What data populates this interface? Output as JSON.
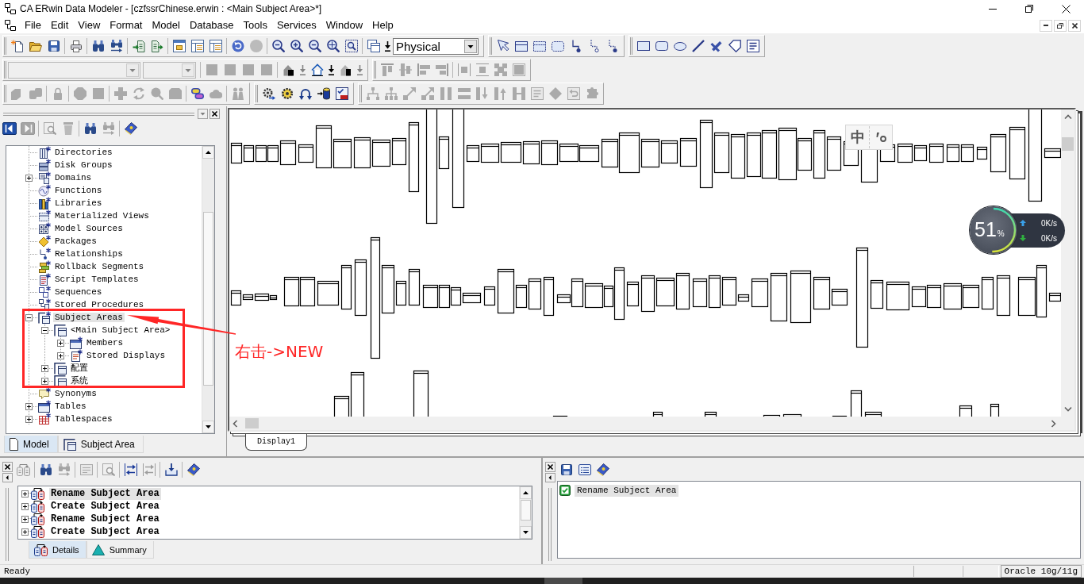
{
  "window": {
    "title": "CA ERwin Data Modeler - [czfssrChinese.erwin : <Main Subject Area>*]"
  },
  "menu": [
    "File",
    "Edit",
    "View",
    "Format",
    "Model",
    "Database",
    "Tools",
    "Services",
    "Window",
    "Help"
  ],
  "toolbars": [
    {
      "combos": [
        {
          "value": "Physical",
          "disabled": false
        }
      ],
      "buttons": [
        {
          "disabled": false
        },
        {
          "disabled": false
        },
        {
          "disabled": false
        },
        {
          "disabled": false
        },
        {
          "disabled": false
        },
        {
          "disabled": false
        },
        {
          "disabled": false
        },
        {
          "disabled": false
        },
        {
          "disabled": false
        },
        {
          "disabled": false
        },
        {
          "disabled": false
        },
        {
          "disabled": false
        },
        {
          "disabled": true
        },
        {
          "disabled": false
        },
        {
          "disabled": false
        },
        {
          "disabled": false
        },
        {
          "disabled": false
        },
        {
          "disabled": false
        },
        {
          "disabled": false
        },
        {
          "disabled": false
        },
        {
          "disabled": false
        },
        {
          "disabled": false
        },
        {
          "disabled": false
        },
        {
          "disabled": false
        },
        {
          "disabled": false
        },
        {
          "disabled": false
        },
        {
          "disabled": false
        },
        {
          "disabled": false
        },
        {
          "disabled": false
        },
        {
          "disabled": false
        },
        {
          "disabled": false
        },
        {
          "disabled": false
        },
        {
          "disabled": false
        },
        {
          "disabled": false
        }
      ]
    },
    {
      "combos": [
        {
          "disabled": true
        },
        {
          "disabled": true
        }
      ],
      "buttons": [
        {
          "disabled": true
        },
        {
          "disabled": true
        },
        {
          "disabled": true
        },
        {
          "disabled": true
        },
        {
          "disabled": false
        },
        {
          "disabled": true
        },
        {
          "disabled": false
        },
        {
          "disabled": false
        },
        {
          "disabled": false
        },
        {
          "disabled": true
        },
        {
          "disabled": true
        },
        {
          "disabled": true
        },
        {
          "disabled": true
        },
        {
          "disabled": true
        },
        {
          "disabled": true
        },
        {
          "disabled": true
        },
        {
          "disabled": true
        },
        {
          "disabled": true
        }
      ]
    },
    {
      "buttons": [
        {
          "disabled": true
        },
        {
          "disabled": true
        },
        {
          "disabled": true
        },
        {
          "disabled": true
        },
        {
          "disabled": true
        },
        {
          "disabled": true
        },
        {
          "disabled": true
        },
        {
          "disabled": true
        },
        {
          "disabled": true
        },
        {
          "disabled": false
        },
        {
          "disabled": true
        },
        {
          "disabled": true
        },
        {
          "disabled": false
        },
        {
          "disabled": false
        },
        {
          "disabled": false
        },
        {
          "disabled": false
        },
        {
          "disabled": false
        },
        {
          "disabled": true
        },
        {
          "disabled": true
        },
        {
          "disabled": true
        },
        {
          "disabled": true
        },
        {
          "disabled": true
        },
        {
          "disabled": true
        },
        {
          "disabled": true
        },
        {
          "disabled": true
        },
        {
          "disabled": true
        },
        {
          "disabled": true
        },
        {
          "disabled": true
        },
        {
          "disabled": true
        },
        {
          "disabled": true
        }
      ]
    }
  ],
  "explorer": {
    "toolbar": [
      {
        "disabled": false
      },
      {
        "disabled": true
      },
      {
        "disabled": true
      },
      {
        "disabled": true
      },
      {
        "disabled": false
      },
      {
        "disabled": true
      },
      {
        "disabled": false
      }
    ],
    "tree": [
      {
        "label": "Directories",
        "kind": "directory",
        "selected": false
      },
      {
        "label": "Disk Groups",
        "kind": "diskgroup",
        "selected": false
      },
      {
        "label": "Domains",
        "kind": "domain",
        "selected": false,
        "expanded": false
      },
      {
        "label": "Functions",
        "kind": "function",
        "selected": false
      },
      {
        "label": "Libraries",
        "kind": "library",
        "selected": false
      },
      {
        "label": "Materialized Views",
        "kind": "matview",
        "selected": false
      },
      {
        "label": "Model Sources",
        "kind": "source",
        "selected": false
      },
      {
        "label": "Packages",
        "kind": "package",
        "selected": false
      },
      {
        "label": "Relationships",
        "kind": "relationship",
        "selected": false
      },
      {
        "label": "Rollback Segments",
        "kind": "rollback",
        "selected": false
      },
      {
        "label": "Script Templates",
        "kind": "script",
        "selected": false
      },
      {
        "label": "Sequences",
        "kind": "sequence",
        "selected": false
      },
      {
        "label": "Stored Procedures",
        "kind": "procedure",
        "selected": false
      },
      {
        "label": "Subject Areas",
        "kind": "subjectareas",
        "selected": true,
        "expanded": true,
        "children": [
          {
            "label": "<Main Subject Area>",
            "kind": "subjectarea",
            "selected": false,
            "expanded": true,
            "children": [
              {
                "label": "Members",
                "kind": "member",
                "selected": false,
                "expanded": false
              },
              {
                "label": "Stored Displays",
                "kind": "display",
                "selected": false,
                "expanded": false
              }
            ]
          },
          {
            "label": "配置",
            "kind": "subjectarea",
            "selected": false,
            "expanded": false
          },
          {
            "label": "系统",
            "kind": "subjectarea",
            "selected": false,
            "expanded": false
          }
        ]
      },
      {
        "label": "Synonyms",
        "kind": "synonym",
        "selected": false
      },
      {
        "label": "Tables",
        "kind": "table",
        "selected": false,
        "expanded": false
      },
      {
        "label": "Tablespaces",
        "kind": "tablespace",
        "selected": false,
        "expanded": false
      }
    ],
    "tabs": [
      {
        "label": "Model",
        "selected": true
      },
      {
        "label": "Subject Area",
        "selected": false
      }
    ]
  },
  "diagram": {
    "tabs": [
      {
        "label": "Display1",
        "selected": true
      }
    ]
  },
  "ime_bar": {
    "mode": "中"
  },
  "speed_widget": {
    "percent": "51",
    "unit": "%",
    "level": 0.51,
    "upload": "0K/s",
    "download": "0K/s"
  },
  "annotation": {
    "text": "右击->NEW"
  },
  "action_log": {
    "toolbar": [
      {
        "disabled": true
      },
      {
        "disabled": false
      },
      {
        "disabled": true
      },
      {
        "disabled": true
      },
      {
        "disabled": true
      },
      {
        "disabled": false
      },
      {
        "disabled": true
      },
      {
        "disabled": false
      },
      {
        "disabled": false
      }
    ],
    "rows": [
      {
        "label": "Rename Subject Area",
        "expanded": false,
        "selected": true
      },
      {
        "label": "Create Subject Area",
        "expanded": false,
        "selected": false
      },
      {
        "label": "Rename Subject Area",
        "expanded": false,
        "selected": false
      },
      {
        "label": "Create Subject Area",
        "expanded": false,
        "selected": false
      }
    ],
    "tabs": [
      {
        "label": "Details",
        "selected": true
      },
      {
        "label": "Summary",
        "selected": false
      }
    ]
  },
  "transaction_log": {
    "toolbar": [
      {
        "disabled": false
      },
      {
        "disabled": false
      },
      {
        "disabled": false
      }
    ],
    "rows": [
      {
        "label": "Rename Subject Area",
        "checked": true,
        "selected": true
      }
    ]
  },
  "status_bar": {
    "message": "Ready",
    "database": "Oracle 10g/11g"
  }
}
